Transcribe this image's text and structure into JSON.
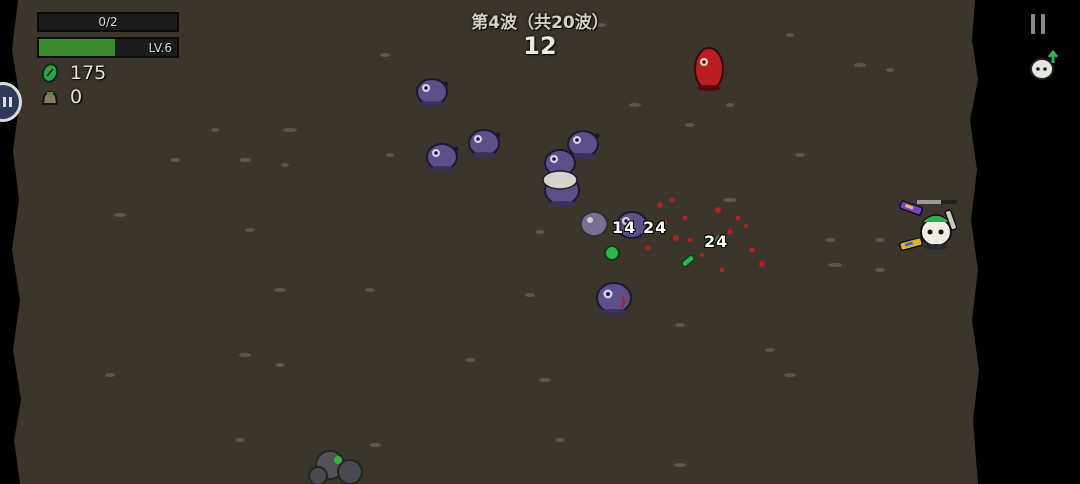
{
  "wave": {
    "title": "第4波（共20波）",
    "timer": "12"
  },
  "player": {
    "xp_text": "0/2",
    "xp_fraction": 0.0,
    "level_text": "LV.6",
    "health_fraction": 0.55
  },
  "resources": {
    "materials": "175",
    "bag": "0"
  },
  "damage_numbers": [
    "14",
    "24",
    "24"
  ],
  "icons": {
    "pause": "pause-icon",
    "upgrade": "level-up-icon",
    "material": "material-icon",
    "bag": "bag-icon",
    "side_button": "joystick-toggle-icon"
  },
  "colors": {
    "ground": "#3b352c",
    "health": "#3c8a2e",
    "enemy": "#5c4f8a",
    "elite_enemy": "#b81e22",
    "blood": "#b32020",
    "material": "#2fb34a"
  }
}
